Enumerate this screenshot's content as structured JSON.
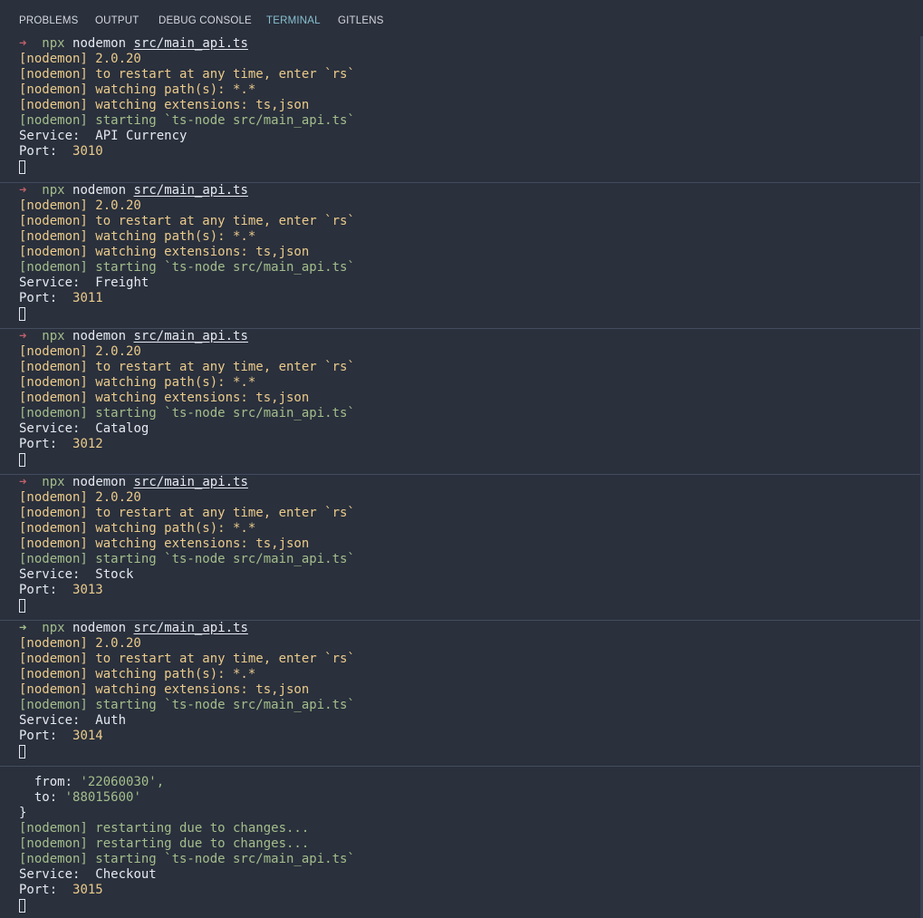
{
  "tabs": [
    {
      "label": "PROBLEMS",
      "active": false
    },
    {
      "label": "OUTPUT",
      "active": false
    },
    {
      "label": "DEBUG CONSOLE",
      "active": false
    },
    {
      "label": "TERMINAL",
      "active": true
    },
    {
      "label": "GITLENS",
      "active": false
    }
  ],
  "prompt": {
    "arrow": "➜",
    "cmd": "npx",
    "rest": "nodemon",
    "file": "src/main_api.ts"
  },
  "nodemon": {
    "version": "[nodemon] 2.0.20",
    "restart_hint": "[nodemon] to restart at any time, enter `rs`",
    "watch_paths": "[nodemon] watching path(s): *.*",
    "watch_ext": "[nodemon] watching extensions: ts,json",
    "starting": "[nodemon] starting `ts-node src/main_api.ts`",
    "restarting": "[nodemon] restarting due to changes..."
  },
  "labels": {
    "service": "Service:",
    "port": "Port:"
  },
  "panes": [
    {
      "service": "API Currency",
      "port": "3010",
      "arrow_color": "#bf616a"
    },
    {
      "service": "Freight",
      "port": "3011",
      "arrow_color": "#bf616a"
    },
    {
      "service": "Catalog",
      "port": "3012",
      "arrow_color": "#bf616a"
    },
    {
      "service": "Stock",
      "port": "3013",
      "arrow_color": "#bf616a"
    },
    {
      "service": "Auth",
      "port": "3014",
      "arrow_color": "#a3be8c"
    }
  ],
  "last_pane": {
    "from_key": "from:",
    "from_val": "'22060030',",
    "to_key": "to:",
    "to_val": "'88015600'",
    "brace": "}",
    "service": "Checkout",
    "port": "3015"
  },
  "colors": {
    "background": "#2a303c",
    "yellow": "#ebcb8b",
    "green": "#a3be8c",
    "red": "#bf616a",
    "active_tab": "#88c0d0"
  }
}
